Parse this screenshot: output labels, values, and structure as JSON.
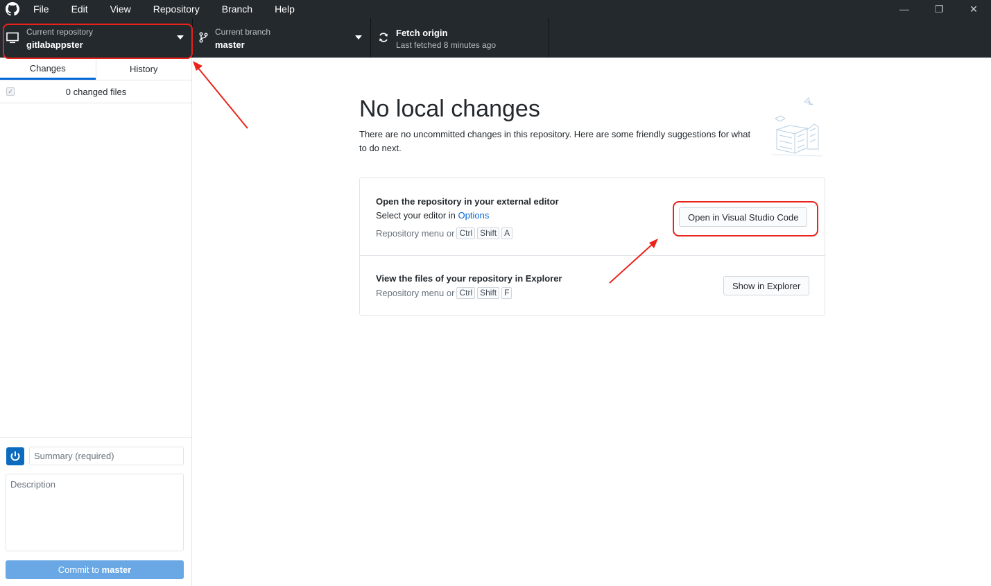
{
  "menu": {
    "items": [
      "File",
      "Edit",
      "View",
      "Repository",
      "Branch",
      "Help"
    ]
  },
  "window_controls": {
    "minimize": "—",
    "restore": "❐",
    "close": "✕"
  },
  "toolbar": {
    "repo_label": "Current repository",
    "repo_value": "gitlabappster",
    "branch_label": "Current branch",
    "branch_value": "master",
    "fetch_label": "Fetch origin",
    "fetch_value": "Last fetched 8 minutes ago"
  },
  "sidebar": {
    "tabs": [
      "Changes",
      "History"
    ],
    "changed_files": "0 changed files",
    "summary_placeholder": "Summary (required)",
    "description_placeholder": "Description",
    "commit_prefix": "Commit to ",
    "commit_branch": "master"
  },
  "main": {
    "title": "No local changes",
    "intro": "There are no uncommitted changes in this repository. Here are some friendly suggestions for what to do next.",
    "editor": {
      "title": "Open the repository in your external editor",
      "sub_prefix": "Select your editor in ",
      "sub_link": "Options",
      "shortcut_prefix": "Repository menu or",
      "keys": [
        "Ctrl",
        "Shift",
        "A"
      ],
      "button": "Open in Visual Studio Code"
    },
    "explorer": {
      "title": "View the files of your repository in Explorer",
      "shortcut_prefix": "Repository menu or",
      "keys": [
        "Ctrl",
        "Shift",
        "F"
      ],
      "button": "Show in Explorer"
    }
  },
  "colors": {
    "annotation": "#e8231b",
    "accent": "#0366d6",
    "toolbar": "#24292e"
  }
}
